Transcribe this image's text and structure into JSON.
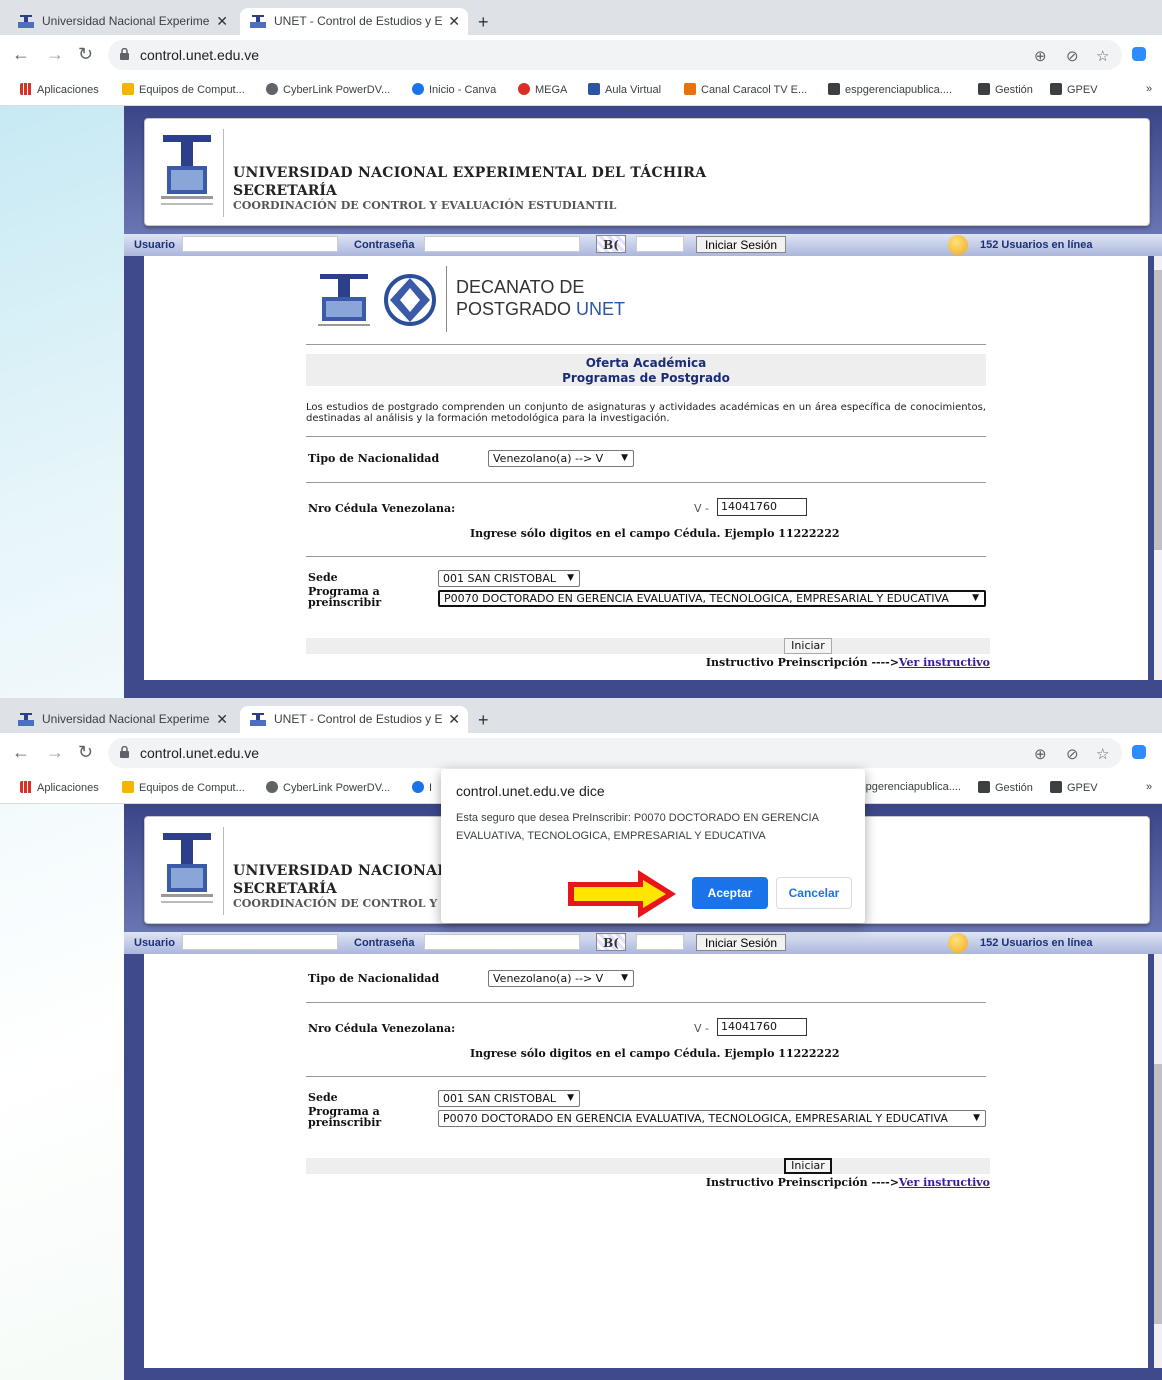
{
  "browser": {
    "tab_inactive_title": "Universidad Nacional Experimental del",
    "tab_active_title": "UNET - Control de Estudios y Evaluación",
    "tab_close": "✕",
    "new_tab": "+",
    "url": "control.unet.edu.ve",
    "bookmarks": [
      {
        "label": "Aplicaciones",
        "color": "#d93025"
      },
      {
        "label": "Equipos de Comput...",
        "color": "#f5b400"
      },
      {
        "label": "CyberLink PowerDV...",
        "color": "#5f6368"
      },
      {
        "label": "Inicio - Canva",
        "color": "#1a73e8"
      },
      {
        "label": "MEGA",
        "color": "#d93025"
      },
      {
        "label": "Aula Virtual",
        "color": "#2b55a3"
      },
      {
        "label": "Canal Caracol TV E...",
        "color": "#e8710a"
      },
      {
        "label": "espgerenciapublica....",
        "color": "#3c4043"
      },
      {
        "label": "Gestión",
        "color": "#3c4043"
      },
      {
        "label": "GPEV",
        "color": "#3c4043"
      }
    ],
    "bookmarks_more": "»",
    "bookmarks_truncated": "I"
  },
  "header": {
    "university": "UNIVERSIDAD NACIONAL EXPERIMENTAL DEL TÁCHIRA",
    "university_short": "UNIVERSIDAD NACIONAL",
    "secretaria": "SECRETARÍA",
    "coordinacion": "COORDINACIÓN DE CONTROL Y EVALUACIÓN ESTUDIANTIL",
    "coordinacion_short": "COORDINACIÓN DE CONTROL Y"
  },
  "login": {
    "usuario_label": "Usuario",
    "password_label": "Contraseña",
    "captcha_text": "B(",
    "login_button": "Iniciar Sesión",
    "online_users": "152 Usuarios en línea"
  },
  "decanato": {
    "line1": "DECANATO DE",
    "line2": "POSTGRADO",
    "line2_accent": " UNET"
  },
  "oferta": {
    "title": "Oferta Académica",
    "subtitle": "Programas de Postgrado",
    "description": "Los estudios de postgrado comprenden un conjunto de asignaturas y actividades académicas en un área específica de conocimientos, destinadas al análisis y la formación metodológica para la investigación."
  },
  "form": {
    "nacionalidad_label": "Tipo de Nacionalidad",
    "nacionalidad_value": "Venezolano(a) --> V",
    "cedula_label": "Nro Cédula Venezolana:",
    "cedula_prefix": "V -",
    "cedula_value": "14041760",
    "cedula_hint": "Ingrese sólo digitos en el campo Cédula. Ejemplo 11222222",
    "sede_label": "Sede",
    "sede_value": "001 SAN CRISTOBAL",
    "programa_label_1": "Programa a",
    "programa_label_2": "preinscribir",
    "programa_value": "P0070 DOCTORADO EN GERENCIA EVALUATIVA, TECNOLOGICA, EMPRESARIAL Y EDUCATIVA",
    "iniciar_button": "Iniciar",
    "instructivo_label": "Instructivo Preinscripción ---->",
    "instructivo_link": "Ver instructivo"
  },
  "dialog": {
    "title": "control.unet.edu.ve dice",
    "message": "Esta seguro que desea PreInscribir: P0070 DOCTORADO EN GERENCIA EVALUATIVA, TECNOLOGICA, EMPRESARIAL Y EDUCATIVA",
    "accept": "Aceptar",
    "cancel": "Cancelar"
  },
  "colors": {
    "header_blue": "#3e4a8c",
    "link_purple": "#3a1c96",
    "accept_blue": "#1a73e8",
    "arrow_red": "#e8161b",
    "arrow_yellow": "#ffe600"
  }
}
